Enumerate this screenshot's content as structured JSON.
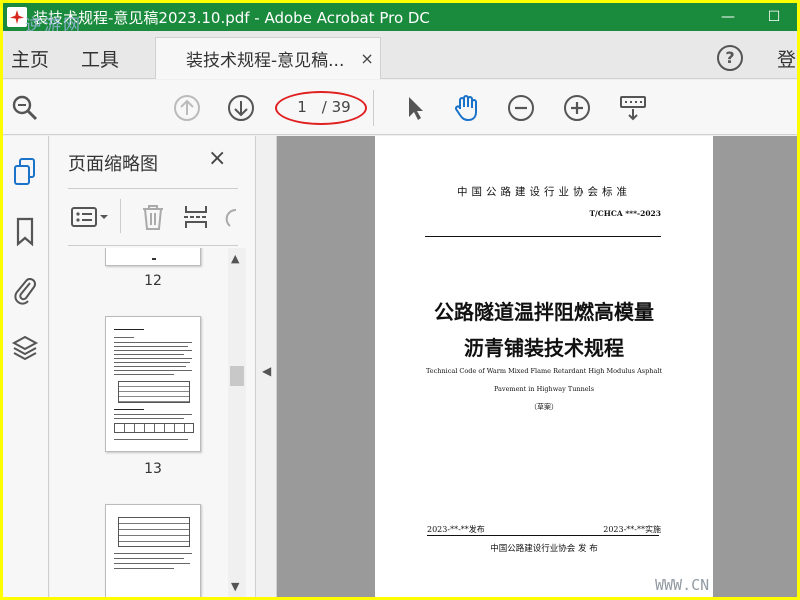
{
  "window": {
    "title": "装技术规程-意见稿2023.10.pdf - Adobe Acrobat Pro DC",
    "watermark": "逆游网",
    "minimize": "—",
    "maximize": "☐"
  },
  "tabs": {
    "home": "主页",
    "tools": "工具",
    "document": "装技术规程-意见稿...",
    "close": "×",
    "help": "?",
    "signin": "登"
  },
  "toolbar": {
    "current_page": "1",
    "total_pages": "/ 39"
  },
  "thumbnails": {
    "title": "页面缩略图",
    "close": "×",
    "pages": [
      {
        "label": "12"
      },
      {
        "label": "13"
      }
    ]
  },
  "document": {
    "org": "中国公路建设行业协会标准",
    "code": "T/CHCA ***-2023",
    "title_line1": "公路隧道温拌阻燃高模量",
    "title_line2": "沥青铺装技术规程",
    "english_line1": "Technical Code of Warm Mixed Flame Retardant High Modulus Asphalt",
    "english_line2": "Pavement in Highway Tunnels",
    "draft": "（草案）",
    "publish": "2023-**-**发布",
    "implement": "2023-**-**实施",
    "issuer": "中国公路建设行业协会  发 布"
  },
  "site_watermark": "WWW.CN",
  "colors": {
    "titlebar": "#1a8a3c",
    "border": "#ffff00",
    "accent_blue": "#1a73c9",
    "annotation_red": "#e02020"
  }
}
